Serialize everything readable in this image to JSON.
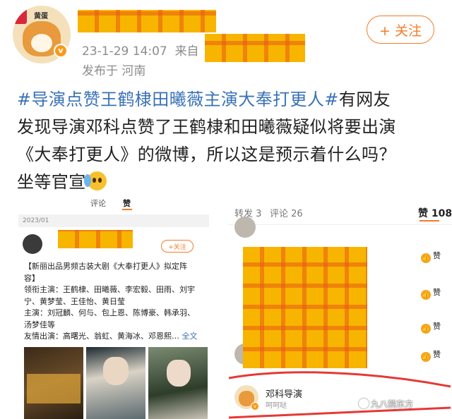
{
  "post": {
    "avatar_brand": "黄蛋",
    "verified_mark": "v",
    "timestamp": "23-1-29 14:07",
    "source_prefix": "来自",
    "location": "发布于 河南",
    "follow_label": "+ 关注",
    "hashtag": "#导演点赞王鹤棣田曦薇主演大奉打更人#",
    "text_line1": "有网友",
    "text_line2": "发现导演邓科点赞了王鹤棣和田曦薇疑似将要出演",
    "text_line3": "《大奉打更人》的微博，所以这是预示着什么吗？",
    "text_line4": "坐等官宣",
    "emoji": "crying-face-emoji"
  },
  "left_screenshot": {
    "tabs": [
      "评论",
      "赞"
    ],
    "active_tab": "赞",
    "date": "2023/01",
    "follow_label": "+关注",
    "body_lines": [
      "【新丽出品男频古装大剧《大奉打更人》拟定阵",
      "容】",
      "领衔主演：王鹤棣、田曦薇、李宏毅、田雨、刘宇",
      "宁、黄梦莹、王佳怡、黄日莹",
      "主演：刘冠麟、何与、包上恩、陈博豪、韩承羽、",
      "汤梦佳等",
      "友情出演：高曙光、翁虹、黄海冰、邓恩熙…"
    ],
    "full_text_label": "全文"
  },
  "right_screenshot": {
    "tabs": {
      "repost": "转发 3",
      "comments": "评论 26",
      "likes": "赞 108"
    },
    "like_label": "赞",
    "highlight_user": {
      "name": "邓科导演",
      "subtitle": "呵呵哒",
      "verified_mark": "v"
    }
  },
  "watermark": "九八鹤东方",
  "colors": {
    "accent_orange": "#f47b2a",
    "hashtag_blue": "#3a72b6",
    "highlight_red": "#e53935",
    "mosaic_yellow": "#f7b500"
  }
}
